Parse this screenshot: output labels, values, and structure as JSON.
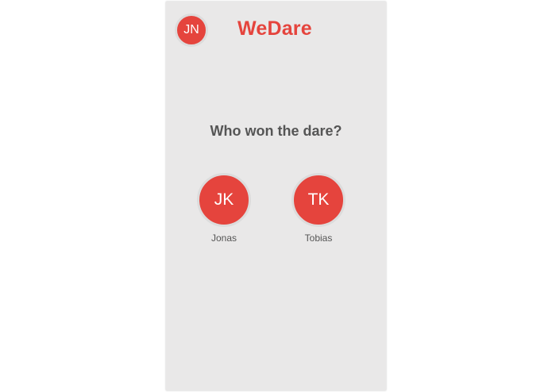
{
  "header": {
    "user_initials": "JN",
    "app_title": "WeDare"
  },
  "main": {
    "question": "Who won the dare?",
    "players": [
      {
        "initials": "JK",
        "name": "Jonas"
      },
      {
        "initials": "TK",
        "name": "Tobias"
      }
    ]
  },
  "colors": {
    "accent": "#e5443d",
    "background": "#e9e8e8",
    "text": "#555555"
  }
}
